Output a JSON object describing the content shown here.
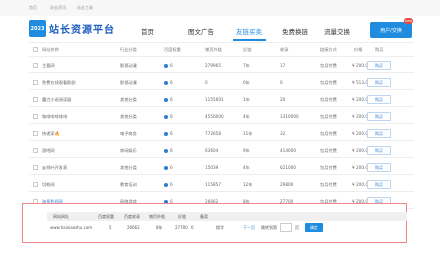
{
  "topbar": {
    "links": [
      "首页",
      "站长资讯",
      "站长工具"
    ]
  },
  "header": {
    "logo_box": "2023",
    "logo_text": "站长资源平台",
    "nav": [
      "首页",
      "图文广告",
      "友链买卖",
      "免费换链",
      "流量交换",
      "网站排行"
    ],
    "active_nav": "友链买卖",
    "user_button": "用户/交换",
    "badge": "new"
  },
  "colors": {
    "accent": "#1f8ce0",
    "highlight_border": "#e88888",
    "badge": "#e64a3b"
  },
  "table": {
    "columns": [
      "网站名称",
      "行业分类",
      "百度权重",
      "铺页外链",
      "反链",
      "收录",
      "链接方式",
      "价格",
      "购买"
    ],
    "rows": [
      {
        "name": "主要网",
        "industry": "影视动漫",
        "weight": "6",
        "links": "279965",
        "anchor": "7年",
        "index": "17",
        "method": "包月付费",
        "price": "¥ 200.00(元)",
        "action": "购买"
      },
      {
        "name": "免费在线观看影剧",
        "industry": "影视动漫",
        "weight": "6",
        "links": "0",
        "anchor": "0年",
        "index": "0",
        "method": "包月付费",
        "price": "¥ 513.00(元)",
        "action": "购买"
      },
      {
        "name": "魔力小说阅读器",
        "industry": "其他分类",
        "weight": "6",
        "links": "1155691",
        "anchor": "1年",
        "index": "20",
        "method": "包月付费",
        "price": "¥ 200.00(元)",
        "action": "购买"
      },
      {
        "name": "咖啡啡啡啡啡",
        "industry": "其他分类",
        "weight": "6",
        "links": "4550000",
        "anchor": "4年",
        "index": "1310000",
        "method": "包月付费",
        "price": "¥ 200.00(元)",
        "action": "购买"
      },
      {
        "name": "快递家",
        "hot": "🔥",
        "industry": "电子商务",
        "weight": "6",
        "links": "772658",
        "anchor": "11年",
        "index": "32",
        "method": "包月付费",
        "price": "¥ 200.00(元)",
        "action": "购买"
      },
      {
        "name": "酒吧网",
        "industry": "休闲娱乐",
        "weight": "6",
        "links": "63604",
        "anchor": "9年",
        "index": "414000",
        "method": "包月付费",
        "price": "¥ 200.00(元)",
        "action": "购买"
      },
      {
        "name": "@领叶开发表",
        "industry": "其他分类",
        "weight": "6",
        "links": "15039",
        "anchor": "4年",
        "index": "621000",
        "method": "包月付费",
        "price": "¥ 200.00(元)",
        "action": "购买"
      },
      {
        "name": "切乾网",
        "industry": "教育培训",
        "weight": "6",
        "links": "115857",
        "anchor": "12年",
        "index": "29800",
        "method": "包月付费",
        "price": "¥ 200.00(元)",
        "action": "购买"
      },
      {
        "name": "海星影视网",
        "industry": "网络游戏",
        "weight": "6",
        "links": "26662",
        "anchor": "8年",
        "index": "27700",
        "method": "包月付费",
        "price": "¥ 200.00(元)",
        "action": "购买"
      }
    ]
  },
  "popup": {
    "headers": [
      "网站网址",
      "百度权重",
      "百度收录",
      "铺页外链",
      "反链",
      "备案"
    ],
    "values": [
      "www.haixiaozhu.com",
      "5",
      "26662",
      "8年",
      "27700",
      "0",
      "搜华"
    ],
    "next_label": "下一页",
    "page_label": "跳转到第",
    "page_suffix": "页",
    "go_button": "确定"
  }
}
